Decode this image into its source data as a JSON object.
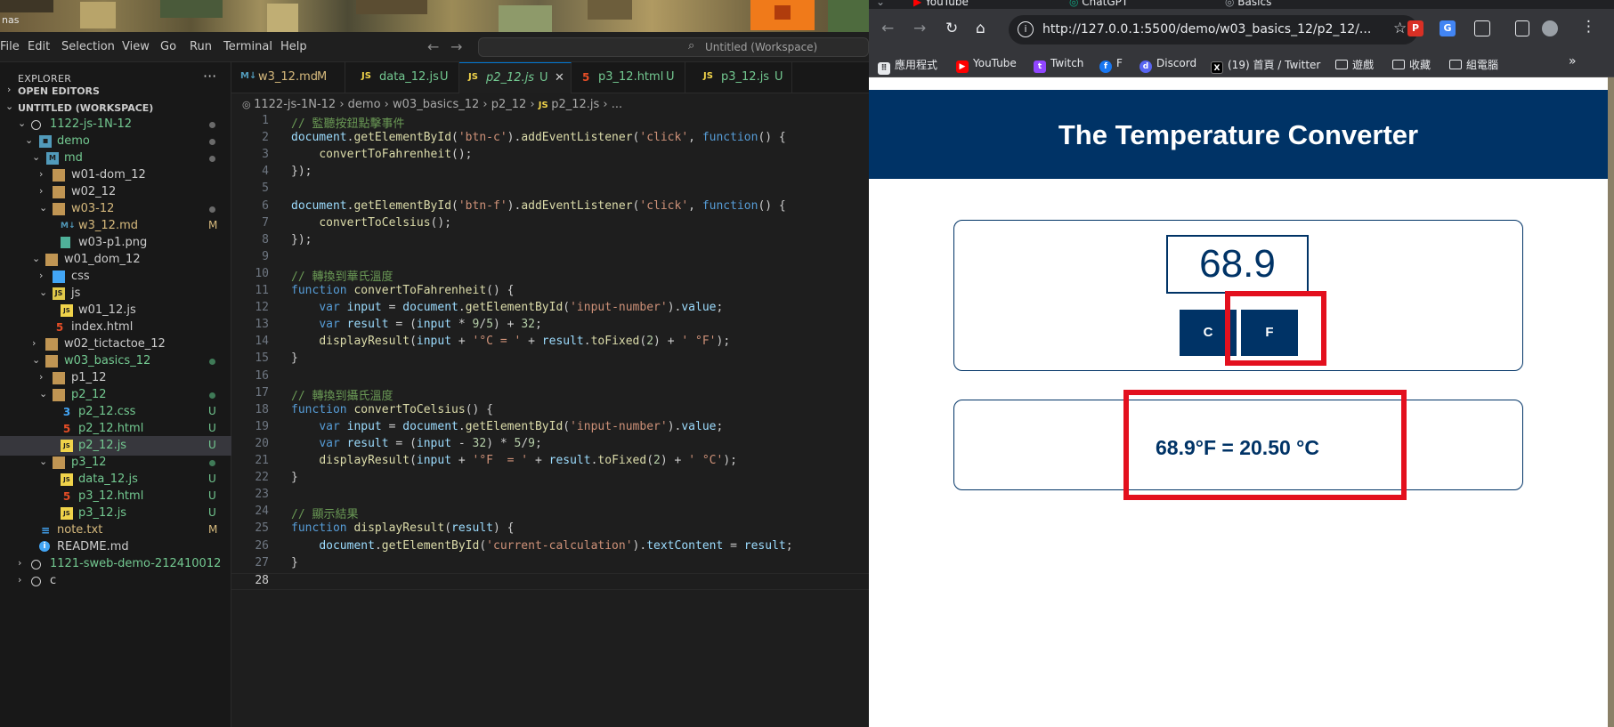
{
  "wallpaper": {
    "label": "nas"
  },
  "vscode": {
    "menu": [
      "File",
      "Edit",
      "Selection",
      "View",
      "Go",
      "Run",
      "Terminal",
      "Help"
    ],
    "command_center": "Untitled (Workspace)",
    "explorer": {
      "title": "EXPLORER",
      "open_editors": "OPEN EDITORS",
      "workspace": "UNTITLED (WORKSPACE)",
      "tree": [
        {
          "label": "1122-js-1N-12",
          "kind": "root",
          "color": "#73c991"
        },
        {
          "label": "demo",
          "kind": "folder"
        },
        {
          "label": "md",
          "kind": "folder"
        },
        {
          "label": "w01-dom_12",
          "kind": "folder"
        },
        {
          "label": "w02_12",
          "kind": "folder"
        },
        {
          "label": "w03-12",
          "kind": "folder"
        },
        {
          "label": "w3_12.md",
          "kind": "md",
          "badge": "M"
        },
        {
          "label": "w03-p1.png",
          "kind": "png"
        },
        {
          "label": "w01_dom_12",
          "kind": "folder"
        },
        {
          "label": "css",
          "kind": "folder"
        },
        {
          "label": "js",
          "kind": "folder"
        },
        {
          "label": "w01_12.js",
          "kind": "js"
        },
        {
          "label": "index.html",
          "kind": "html"
        },
        {
          "label": "w02_tictactoe_12",
          "kind": "folder"
        },
        {
          "label": "w03_basics_12",
          "kind": "folder"
        },
        {
          "label": "p1_12",
          "kind": "folder"
        },
        {
          "label": "p2_12",
          "kind": "folder"
        },
        {
          "label": "p2_12.css",
          "kind": "css",
          "badge": "U"
        },
        {
          "label": "p2_12.html",
          "kind": "html",
          "badge": "U"
        },
        {
          "label": "p2_12.js",
          "kind": "js",
          "badge": "U"
        },
        {
          "label": "p3_12",
          "kind": "folder"
        },
        {
          "label": "data_12.js",
          "kind": "js",
          "badge": "U"
        },
        {
          "label": "p3_12.html",
          "kind": "html",
          "badge": "U"
        },
        {
          "label": "p3_12.js",
          "kind": "js",
          "badge": "U"
        },
        {
          "label": "note.txt",
          "kind": "txt",
          "badge": "M"
        },
        {
          "label": "README.md",
          "kind": "info"
        },
        {
          "label": "1121-sweb-demo-212410012",
          "kind": "root"
        },
        {
          "label": "c",
          "kind": "root"
        }
      ]
    },
    "tabs": [
      {
        "label": "w3_12.md",
        "status": "M"
      },
      {
        "label": "data_12.js",
        "status": "U"
      },
      {
        "label": "p2_12.js",
        "status": "U"
      },
      {
        "label": "p3_12.html",
        "status": "U"
      },
      {
        "label": "p3_12.js",
        "status": "U"
      }
    ],
    "breadcrumb": [
      "1122-js-1N-12",
      "demo",
      "w03_basics_12",
      "p2_12",
      "p2_12.js",
      "..."
    ],
    "code_lines": [
      "// 監聽按鈕點擊事件",
      "document.getElementById('btn-c').addEventListener('click', function() {",
      "    convertToFahrenheit();",
      "});",
      "",
      "document.getElementById('btn-f').addEventListener('click', function() {",
      "    convertToCelsius();",
      "});",
      "",
      "// 轉換到華氏溫度",
      "function convertToFahrenheit() {",
      "    var input = document.getElementById('input-number').value;",
      "    var result = (input * 9/5) + 32;",
      "    displayResult(input + '°C = ' + result.toFixed(2) + ' °F');",
      "}",
      "",
      "// 轉換到攝氏溫度",
      "function convertToCelsius() {",
      "    var input = document.getElementById('input-number').value;",
      "    var result = (input - 32) * 5/9;",
      "    displayResult(input + '°F  = ' + result.toFixed(2) + ' °C');",
      "}",
      "",
      "// 顯示結果",
      "function displayResult(result) {",
      "    document.getElementById('current-calculation').textContent = result;",
      "}",
      ""
    ]
  },
  "chrome": {
    "tabs": [
      "YouTube",
      "ChatGPT",
      "Basics"
    ],
    "url": "http://127.0.0.1:5500/demo/w03_basics_12/p2_12/...",
    "bookmarks": [
      "應用程式",
      "YouTube",
      "Twitch",
      "F",
      "Discord",
      "(19) 首頁 / Twitter",
      "遊戲",
      "收藏",
      "組電腦"
    ],
    "page": {
      "title": "The Temperature Converter",
      "input_value": "68.9",
      "btn_c": "C",
      "btn_f": "F",
      "result": "68.9°F = 20.50 °C",
      "brand_color": "#003366",
      "highlight_color": "#e3101e"
    }
  }
}
